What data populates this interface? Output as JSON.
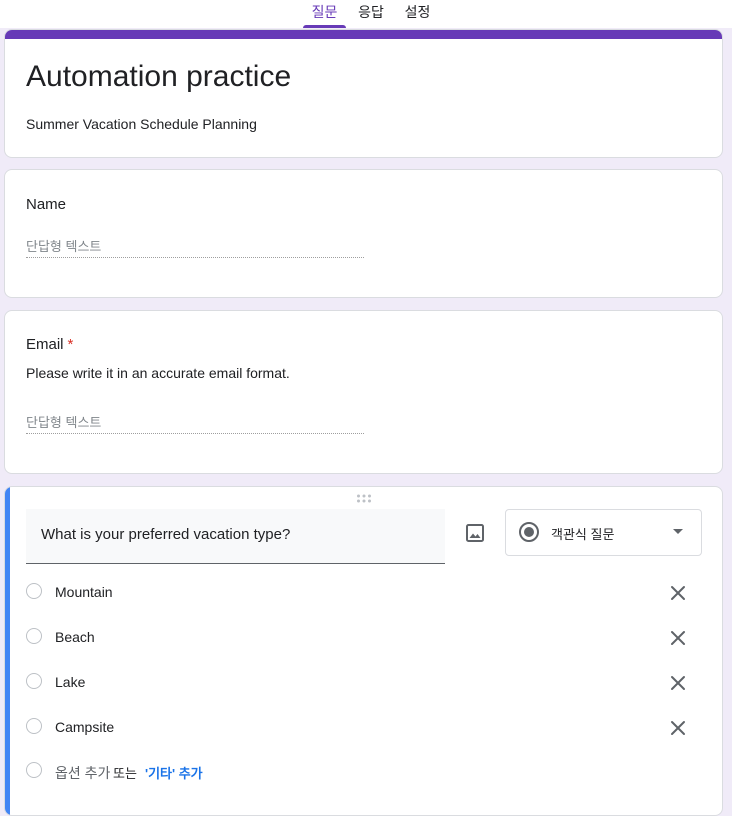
{
  "tabs": [
    {
      "label": "질문",
      "active": true
    },
    {
      "label": "응답",
      "active": false
    },
    {
      "label": "설정",
      "active": false
    }
  ],
  "form": {
    "title": "Automation practice",
    "description": "Summer Vacation Schedule Planning"
  },
  "questions": {
    "name": {
      "title": "Name",
      "placeholder": "단답형 텍스트"
    },
    "email": {
      "title": "Email",
      "required_mark": "*",
      "description": "Please write it in an accurate email format.",
      "placeholder": "단답형 텍스트"
    },
    "vacation": {
      "title": "What is your preferred vacation type?",
      "type_label": "객관식 질문",
      "options": [
        "Mountain",
        "Beach",
        "Lake",
        "Campsite"
      ],
      "add_option": "옵션 추가",
      "or_text": "또는",
      "add_other": "'기타' 추가"
    }
  },
  "colors": {
    "theme": "#673ab7",
    "background": "#f0ebf8",
    "active_question": "#4285f4",
    "link": "#1a73e8"
  },
  "icons": {
    "image": "image-icon",
    "type_radio": "radio-button-checked-icon",
    "dropdown": "arrow-drop-down-icon",
    "remove": "close-icon",
    "drag": "drag-handle-icon"
  }
}
